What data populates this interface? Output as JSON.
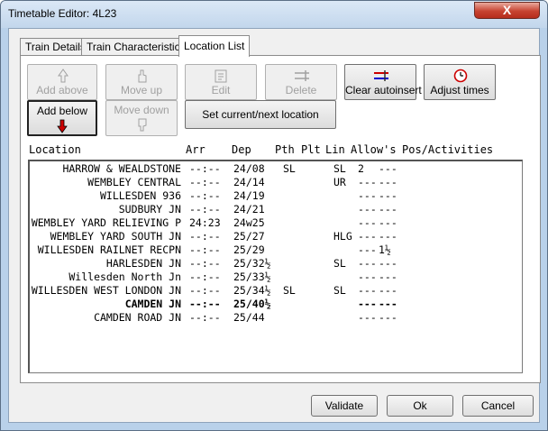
{
  "window": {
    "title": "Timetable Editor: 4L23",
    "close_label": "X"
  },
  "tabs": [
    {
      "label": "Train Details",
      "active": false
    },
    {
      "label": "Train Characteristics",
      "active": false
    },
    {
      "label": "Location List",
      "active": true
    }
  ],
  "toolbar": {
    "add_above": "Add above",
    "move_up": "Move up",
    "edit": "Edit",
    "delete": "Delete",
    "clear_autoinsert": "Clear autoinsert",
    "adjust_times": "Adjust times",
    "add_below": "Add below",
    "move_down": "Move down",
    "set_current_next": "Set current/next location"
  },
  "list_headers": {
    "location": "Location",
    "arr": "Arr",
    "dep": "Dep",
    "pth": "Pth",
    "plt": "Plt",
    "lin": "Lin",
    "allows": "Allow's",
    "pos_activities": "Pos/Activities"
  },
  "rows": [
    {
      "location": "HARROW & WEALDSTONE",
      "arr": "--:--",
      "dep": "24/08",
      "pth": "SL",
      "plt": "",
      "lin": "SL",
      "allow1": "2",
      "allow2": "---",
      "pos": "",
      "bold": false
    },
    {
      "location": "WEMBLEY CENTRAL",
      "arr": "--:--",
      "dep": "24/14",
      "pth": "",
      "plt": "",
      "lin": "UR",
      "allow1": "---",
      "allow2": "---",
      "pos": "",
      "bold": false
    },
    {
      "location": "WILLESDEN 936",
      "arr": "--:--",
      "dep": "24/19",
      "pth": "",
      "plt": "",
      "lin": "",
      "allow1": "---",
      "allow2": "---",
      "pos": "",
      "bold": false
    },
    {
      "location": "SUDBURY JN",
      "arr": "--:--",
      "dep": "24/21",
      "pth": "",
      "plt": "",
      "lin": "",
      "allow1": "---",
      "allow2": "---",
      "pos": "",
      "bold": false
    },
    {
      "location": "WEMBLEY YARD RELIEVING P",
      "arr": "24:23",
      "dep": "24w25",
      "pth": "",
      "plt": "",
      "lin": "",
      "allow1": "---",
      "allow2": "---",
      "pos": "",
      "bold": false
    },
    {
      "location": "WEMBLEY YARD SOUTH JN",
      "arr": "--:--",
      "dep": "25/27",
      "pth": "",
      "plt": "",
      "lin": "HLG",
      "allow1": "---",
      "allow2": "---",
      "pos": "",
      "bold": false
    },
    {
      "location": "WILLESDEN RAILNET RECPN",
      "arr": "--:--",
      "dep": "25/29",
      "pth": "",
      "plt": "",
      "lin": "",
      "allow1": "---",
      "allow2": "1½",
      "pos": "",
      "bold": false
    },
    {
      "location": "HARLESDEN JN",
      "arr": "--:--",
      "dep": "25/32½",
      "pth": "",
      "plt": "",
      "lin": "SL",
      "allow1": "---",
      "allow2": "---",
      "pos": "",
      "bold": false
    },
    {
      "location": "Willesden North Jn",
      "arr": "--:--",
      "dep": "25/33½",
      "pth": "",
      "plt": "",
      "lin": "",
      "allow1": "---",
      "allow2": "---",
      "pos": "",
      "bold": false
    },
    {
      "location": "WILLESDEN WEST LONDON JN",
      "arr": "--:--",
      "dep": "25/34½",
      "pth": "SL",
      "plt": "",
      "lin": "SL",
      "allow1": "---",
      "allow2": "---",
      "pos": "",
      "bold": false
    },
    {
      "location": "CAMDEN JN",
      "arr": "--:--",
      "dep": "25/40½",
      "pth": "",
      "plt": "",
      "lin": "",
      "allow1": "---",
      "allow2": "---",
      "pos": "",
      "bold": true
    },
    {
      "location": "CAMDEN ROAD JN",
      "arr": "--:--",
      "dep": "25/44",
      "pth": "",
      "plt": "",
      "lin": "",
      "allow1": "---",
      "allow2": "---",
      "pos": "",
      "bold": false
    }
  ],
  "footer": {
    "validate": "Validate",
    "ok": "Ok",
    "cancel": "Cancel"
  },
  "colors": {
    "frame": "#b9d1ea",
    "close": "#c74331",
    "arrow_red": "#cc0000",
    "arrow_blue": "#0000cc"
  }
}
